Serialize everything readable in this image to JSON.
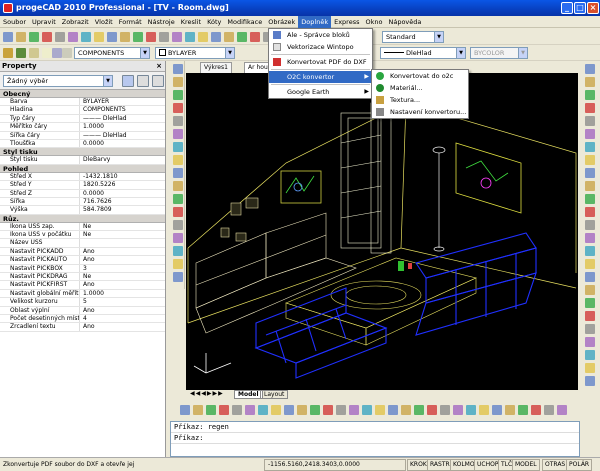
{
  "window": {
    "title": "progeCAD 2010 Professional - [TV - Room.dwg]",
    "min": "_",
    "max": "□",
    "close": "×"
  },
  "menu": {
    "items": [
      "Soubor",
      "Upravit",
      "Zobrazit",
      "Vložit",
      "Formát",
      "Nástroje",
      "Kreslit",
      "Kóty",
      "Modifikace",
      "Obrázek",
      "Doplněk",
      "Express",
      "Okno",
      "Nápověda"
    ],
    "active": "Doplněk"
  },
  "toolbar2": {
    "layer": "COMPONENTS",
    "color": "BYLAYER",
    "style": "Standard",
    "linetype": "DleHlad",
    "bycolor": "BYCOLOR"
  },
  "dropdown": {
    "items": [
      {
        "label": "Ale - Správce bloků",
        "icon": "block-manager-icon"
      },
      {
        "label": "Vektorizace Wintopo",
        "icon": "wintopo-icon"
      },
      {
        "label": "Konvertovat PDF do DXF",
        "icon": "pdf-icon"
      },
      {
        "label": "O2C konvertor",
        "icon": "o2c-icon",
        "submenu": true
      },
      {
        "label": "Google Earth",
        "icon": "",
        "submenu": true
      }
    ],
    "submenu": [
      "Konvertovat do o2c",
      "Materiál...",
      "Textura...",
      "Nastavení konvertoru..."
    ]
  },
  "panel": {
    "title": "Property",
    "selection": "Žádný výběr",
    "sections": [
      {
        "name": "Obecný",
        "rows": [
          [
            "Barva",
            "BYLAYER"
          ],
          [
            "Hladina",
            "COMPONENTS"
          ],
          [
            "Typ čáry",
            "——— DleHlad"
          ],
          [
            "Měřítko čáry",
            "1.0000"
          ],
          [
            "Šířka čáry",
            "——— DleHlad"
          ],
          [
            "Tloušťka",
            "0.0000"
          ]
        ]
      },
      {
        "name": "Styl tisku",
        "rows": [
          [
            "Styl tisku",
            "DleBarvy"
          ]
        ]
      },
      {
        "name": "Pohled",
        "rows": [
          [
            "Střed X",
            "-1432.1810"
          ],
          [
            "Střed Y",
            "1820.5226"
          ],
          [
            "Střed Z",
            "0.0000"
          ],
          [
            "Šířka",
            "716.7626"
          ],
          [
            "Výška",
            "584.7809"
          ]
        ]
      },
      {
        "name": "Růz.",
        "rows": [
          [
            "Ikona USS zap.",
            "Ne"
          ],
          [
            "Ikona USS v počátku",
            "Ne"
          ],
          [
            "Název USS",
            ""
          ],
          [
            "Nastavit PICKADD",
            "Ano"
          ],
          [
            "Nastavit PICKAUTO",
            "Ano"
          ],
          [
            "Nastavit PICKBOX",
            "3"
          ],
          [
            "Nastavit PICKDRAG",
            "Ne"
          ],
          [
            "Nastavit PICKFIRST",
            "Ano"
          ],
          [
            "Nastavit globální měřít..",
            "1.0000"
          ],
          [
            "Velikost kurzoru",
            "5"
          ],
          [
            "Oblast výplní",
            "Ano"
          ],
          [
            "Počet desetinných míst",
            "4"
          ],
          [
            "Zrcadlení textu",
            "Ano"
          ]
        ]
      }
    ]
  },
  "doctabs": [
    "Výkres1",
    "Ar hou"
  ],
  "layouttabs": [
    "Model",
    "Layout"
  ],
  "command": {
    "lines": [
      "Příkaz: regen",
      "Příkaz:"
    ]
  },
  "status": {
    "hint": "Zkonvertuje PDF soubor do DXF a otevře jej",
    "coords": "-1156.5160,2418.3403,0.0000",
    "buttons": [
      "KROK",
      "RASTR",
      "KOLMO",
      "UCHOP",
      "TLČ",
      "MODEL",
      "OTRAS",
      "POLÁR"
    ]
  },
  "colors": {
    "accent": "#316ac5",
    "titlebar": "#0a56e6",
    "wire_yellow": "#e8e060",
    "wire_blue": "#2030ff"
  }
}
